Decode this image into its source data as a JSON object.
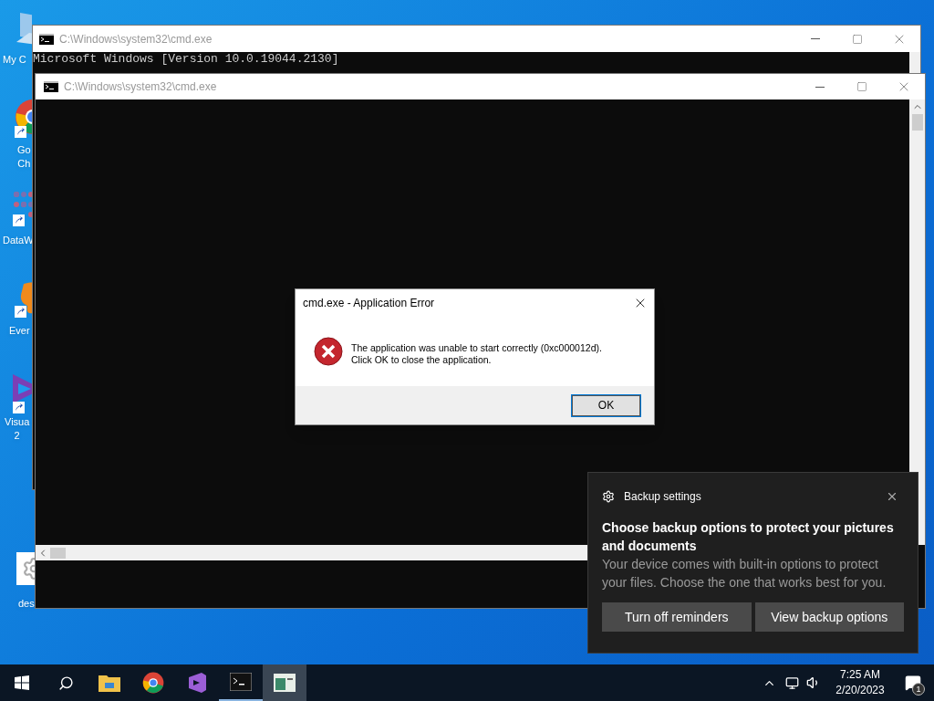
{
  "desktop_icons": [
    {
      "kind": "computer",
      "lines": [
        "My C"
      ]
    },
    {
      "kind": "chrome",
      "lines": [
        "Go",
        "Ch"
      ]
    },
    {
      "kind": "dots",
      "lines": [
        "DataW"
      ]
    },
    {
      "kind": "elephant",
      "lines": [
        "Ever"
      ]
    },
    {
      "kind": "studio",
      "lines": [
        "Visua",
        "2"
      ]
    },
    {
      "kind": "gear",
      "lines": [
        "des"
      ]
    }
  ],
  "windows": [
    {
      "title": "C:\\Windows\\system32\\cmd.exe",
      "lines": [
        "Microsoft Windows [Version 10.0.19044.2130]"
      ]
    },
    {
      "title": "C:\\Windows\\system32\\cmd.exe"
    }
  ],
  "dialog": {
    "title": "cmd.exe - Application Error",
    "message": [
      "The application was unable to start correctly (0xc000012d).",
      "Click OK to close the application."
    ],
    "button": "OK"
  },
  "notification": {
    "app": "Backup settings",
    "heading": "Choose backup options to protect your pictures and documents",
    "body": "Your device comes with built-in options to protect your files. Choose the one that works best for you.",
    "buttons": [
      "Turn off reminders",
      "View backup options"
    ]
  },
  "taskbar": {
    "apps": [
      {
        "kind": "folder",
        "running": false,
        "selected": false
      },
      {
        "kind": "chrome",
        "running": false,
        "selected": false
      },
      {
        "kind": "studio",
        "running": false,
        "selected": false
      },
      {
        "kind": "console",
        "running": true,
        "selected": false
      },
      {
        "kind": "form",
        "running": false,
        "selected": true
      }
    ],
    "time": "7:25 AM",
    "date": "2/20/2023",
    "badge": "1"
  }
}
